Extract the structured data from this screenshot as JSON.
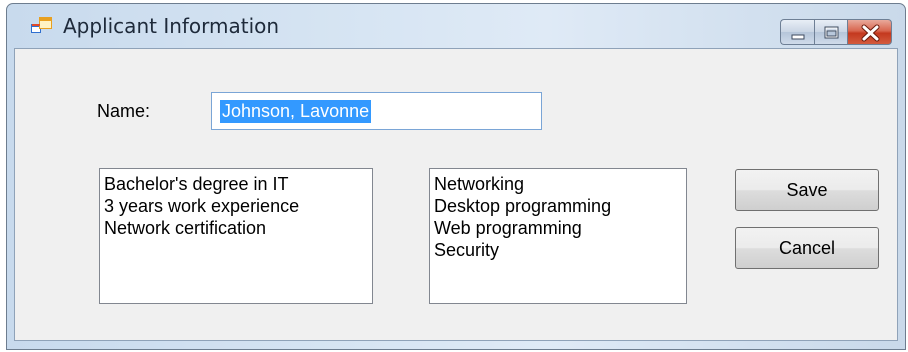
{
  "window": {
    "title": "Applicant Information"
  },
  "form": {
    "name_label": "Name:",
    "name_value": "Johnson, Lavonne"
  },
  "qualifications": {
    "items": [
      "Bachelor's degree in IT",
      "3 years work experience",
      "Network certification"
    ]
  },
  "skills": {
    "items": [
      "Networking",
      "Desktop programming",
      "Web programming",
      "Security"
    ]
  },
  "buttons": {
    "save_label": "Save",
    "cancel_label": "Cancel"
  },
  "icons": {
    "app": "form-window-icon",
    "minimize": "minimize-icon",
    "maximize": "maximize-icon",
    "close": "close-icon"
  },
  "colors": {
    "selection": "#3399ff",
    "close_button": "#c4391f"
  }
}
